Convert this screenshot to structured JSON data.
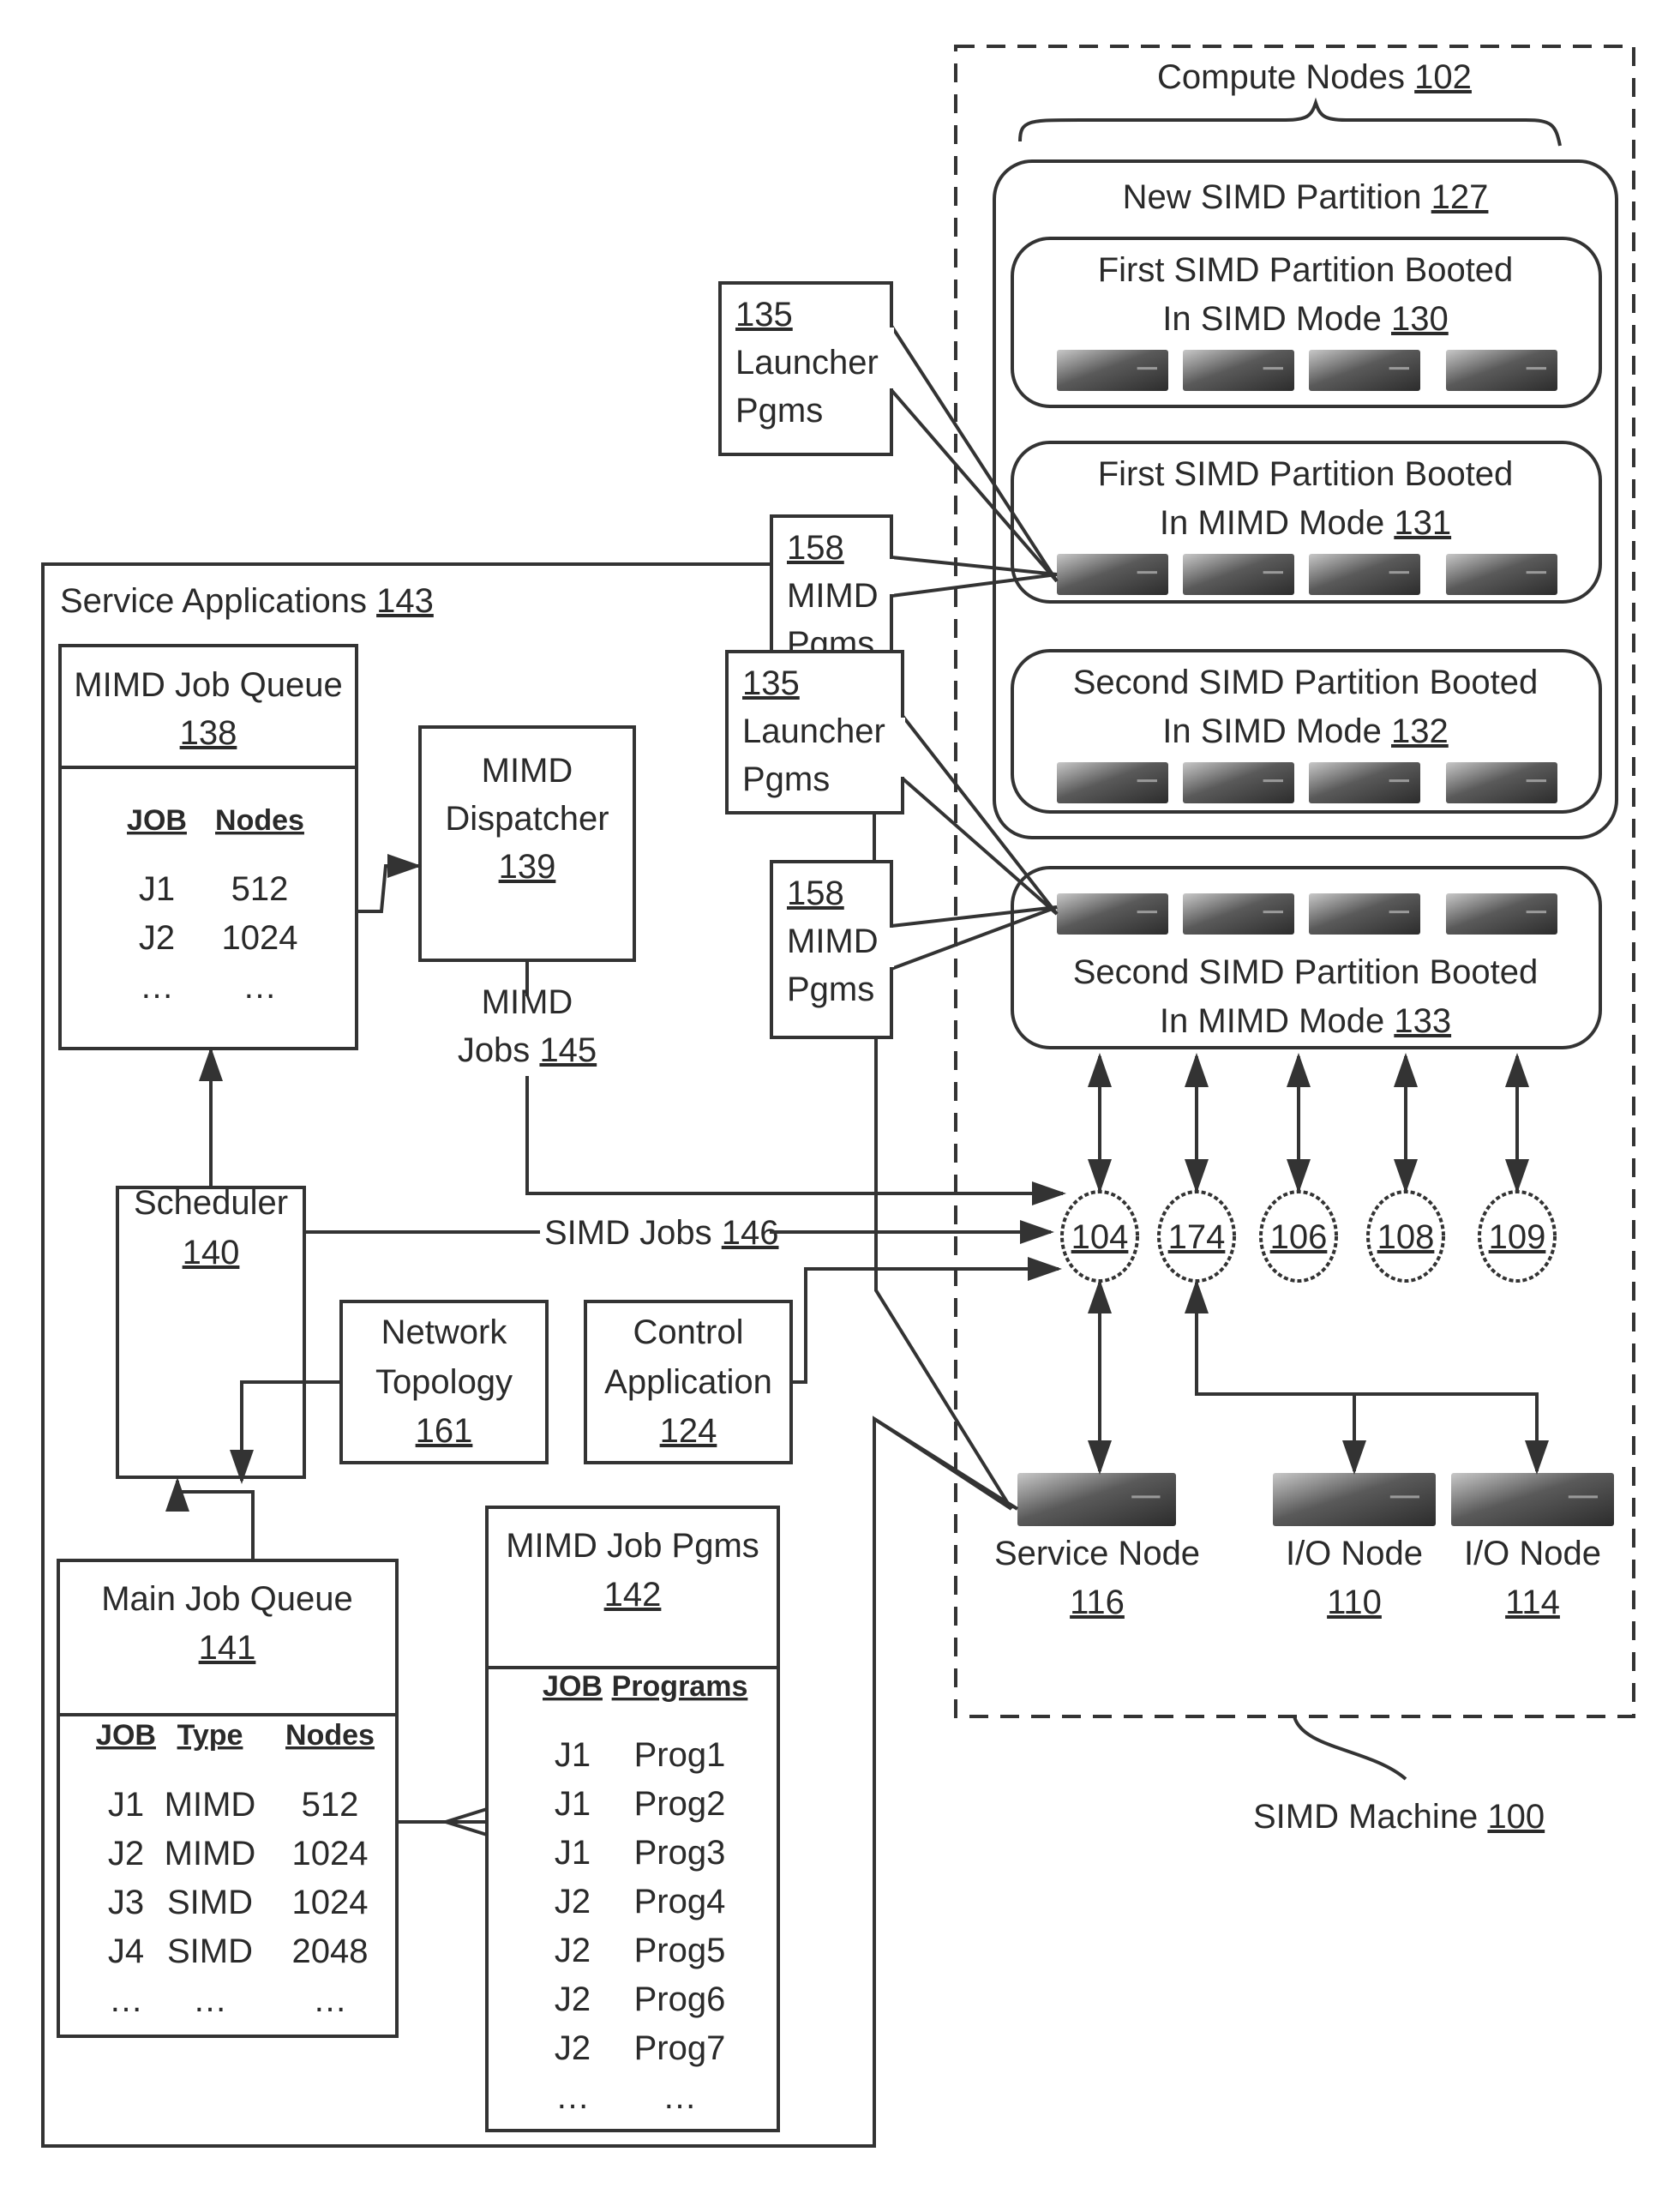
{
  "figure": {
    "machine": {
      "label": "SIMD Machine",
      "ref": "100"
    },
    "compute_nodes": {
      "label": "Compute Nodes",
      "ref": "102"
    },
    "new_partition": {
      "label": "New SIMD Partition",
      "ref": "127"
    },
    "partitions": [
      {
        "line1": "First SIMD Partition Booted",
        "line2": "In SIMD Mode",
        "ref": "130"
      },
      {
        "line1": "First SIMD Partition Booted",
        "line2": "In MIMD Mode",
        "ref": "131"
      },
      {
        "line1": "Second SIMD Partition Booted",
        "line2": "In SIMD Mode",
        "ref": "132"
      },
      {
        "line1": "Second SIMD Partition Booted",
        "line2": "In MIMD Mode",
        "ref": "133"
      }
    ],
    "callouts": [
      {
        "ref": "135",
        "line1": "Launcher",
        "line2": "Pgms"
      },
      {
        "ref": "158",
        "line1": "MIMD",
        "line2": "Pgms"
      },
      {
        "ref": "135",
        "line1": "Launcher",
        "line2": "Pgms"
      },
      {
        "ref": "158",
        "line1": "MIMD",
        "line2": "Pgms"
      }
    ],
    "network_nodes": [
      "104",
      "174",
      "106",
      "108",
      "109"
    ],
    "service_node": {
      "label": "Service Node",
      "ref": "116"
    },
    "io_nodes": [
      {
        "label": "I/O Node",
        "ref": "110"
      },
      {
        "label": "I/O Node",
        "ref": "114"
      }
    ],
    "service_apps": {
      "label": "Service Applications",
      "ref": "143"
    },
    "mimd_job_queue": {
      "title": "MIMD Job Queue",
      "ref": "138",
      "headers": [
        "JOB",
        "Nodes"
      ],
      "rows": [
        [
          "J1",
          "512"
        ],
        [
          "J2",
          "1024"
        ],
        [
          "…",
          "…"
        ]
      ]
    },
    "dispatcher": {
      "line1": "MIMD",
      "line2": "Dispatcher",
      "ref": "139"
    },
    "mimd_jobs": {
      "line1": "MIMD",
      "line2": "Jobs",
      "ref": "145"
    },
    "simd_jobs": {
      "label": "SIMD Jobs",
      "ref": "146"
    },
    "scheduler": {
      "label": "Scheduler",
      "ref": "140"
    },
    "network_topology": {
      "line1": "Network",
      "line2": "Topology",
      "ref": "161"
    },
    "control_app": {
      "line1": "Control",
      "line2": "Application",
      "ref": "124"
    },
    "main_job_queue": {
      "title": "Main Job Queue",
      "ref": "141",
      "headers": [
        "JOB",
        "Type",
        "Nodes"
      ],
      "rows": [
        [
          "J1",
          "MIMD",
          "512"
        ],
        [
          "J2",
          "MIMD",
          "1024"
        ],
        [
          "J3",
          "SIMD",
          "1024"
        ],
        [
          "J4",
          "SIMD",
          "2048"
        ],
        [
          "…",
          "…",
          "…"
        ]
      ]
    },
    "mimd_job_pgms": {
      "title": "MIMD Job Pgms",
      "ref": "142",
      "headers": [
        "JOB",
        "Programs"
      ],
      "rows": [
        [
          "J1",
          "Prog1"
        ],
        [
          "J1",
          "Prog2"
        ],
        [
          "J1",
          "Prog3"
        ],
        [
          "J2",
          "Prog4"
        ],
        [
          "J2",
          "Prog5"
        ],
        [
          "J2",
          "Prog6"
        ],
        [
          "J2",
          "Prog7"
        ],
        [
          "…",
          "…"
        ]
      ]
    },
    "colors": {
      "ink": "#333333",
      "server_dark": "#3a3a3a",
      "server_light": "#bdbdbd"
    }
  }
}
